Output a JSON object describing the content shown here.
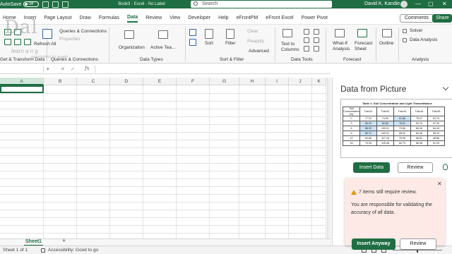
{
  "titlebar": {
    "autosave": "AutoSave",
    "autosave_state": "Off",
    "title_parts": [
      "Book3",
      "Excel",
      "No Label"
    ],
    "search": "Search",
    "user": "David K. Kandie",
    "controls": [
      "—",
      "▢",
      "✕"
    ]
  },
  "tabs": [
    "Home",
    "Insert",
    "Page Layout",
    "Draw",
    "Formulas",
    "Data",
    "Review",
    "View",
    "Developer",
    "Help",
    "eFrontPM",
    "eFront Excel",
    "Power Pivot"
  ],
  "active_tab": "Data",
  "top_buttons": {
    "comments": "Comments",
    "share": "Share"
  },
  "ribbon": {
    "groups": {
      "get_transform": "Get & Transform Data",
      "queries": "Queries & Connections",
      "data_types": "Data Types",
      "sort_filter": "Sort & Filter",
      "data_tools": "Data Tools",
      "forecast": "Forecast",
      "analysis": "Analysis"
    },
    "items": {
      "queries_connections": "Queries & Connections",
      "properties": "Properties",
      "refresh_all": "Refresh All",
      "organization": "Organization",
      "active_team": "Active Tea...",
      "sort": "Sort",
      "filter": "Filter",
      "clear": "Clear",
      "reapply": "Reapply",
      "advanced": "Advanced",
      "text_to_columns": "Text to Columns",
      "what_if": "What-If Analysis",
      "forecast_sheet": "Forecast Sheet",
      "outline": "Outline",
      "solver": "Solver",
      "data_analysis": "Data Analysis"
    }
  },
  "watermark": {
    "big": "Dal",
    "small": "learn  a  n g",
    "tiny": "opportunities for growth"
  },
  "formula_bar": {
    "name_box": "",
    "fx": "fx",
    "content": ""
  },
  "columns": [
    "A",
    "B",
    "C",
    "D",
    "E",
    "F",
    "G",
    "H",
    "I",
    "J",
    "K"
  ],
  "sheet": {
    "tab": "Sheet1",
    "add": "+"
  },
  "status": {
    "sheet_of": "Sheet 1 of 1",
    "accessibility": "Accessibility: Good to go"
  },
  "pane": {
    "title": "Data from Picture",
    "preview_title": "Table 1: Soil Concentration and Light Transmittance",
    "preview_header": [
      "Soil Concentration (%)",
      "Trial #1",
      "Trial #2",
      "Trial #3",
      "Trial #4",
      "Trial #5"
    ],
    "preview_group": "Transmittance (%T)",
    "preview_rows": [
      [
        "0",
        "77.23",
        "74.90",
        "61.86",
        "75.27",
        "63.74"
      ],
      [
        "3",
        "83.23",
        "82.82",
        "78.91",
        "60.75",
        "57.00"
      ],
      [
        "6",
        "88.20",
        "100.01",
        "73.66",
        "66.16",
        "64.44"
      ],
      [
        "9",
        "80.71",
        "100.01",
        "68.20",
        "64.45",
        "55.10"
      ],
      [
        "12",
        "82.66",
        "117.18",
        "75.35",
        "56.81",
        "48.86"
      ],
      [
        "15",
        "73.33",
        "115.48",
        "60.73",
        "66.08",
        "51.23"
      ]
    ],
    "insert_data": "Insert Data",
    "review": "Review",
    "notice_title": "7 items still require review.",
    "notice_body": "You are responsible for validating the accuracy of all data.",
    "insert_anyway": "Insert Anyway",
    "review2": "Review"
  },
  "colors": {
    "accent": "#1f6e43",
    "notice_bg": "#fdeae6",
    "warning": "#d99b00"
  }
}
